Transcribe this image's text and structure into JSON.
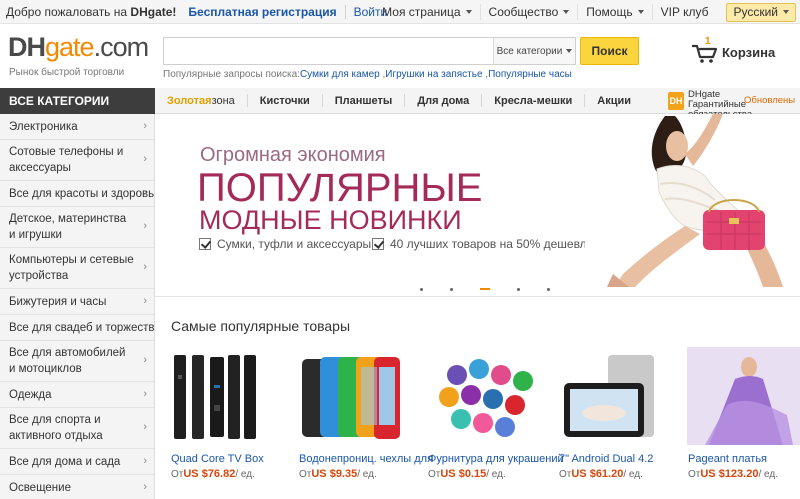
{
  "topbar": {
    "welcome": "Добро пожаловать на ",
    "welcome_brand": "DHgate!",
    "register": "Бесплатная регистрация",
    "login": "Войти",
    "my_page": "Моя страница",
    "community": "Сообщество",
    "help": "Помощь",
    "vip": "VIP клуб",
    "language": "Русский"
  },
  "header": {
    "logo_dh": "DH",
    "logo_gate": "gate",
    "logo_com": ".com",
    "tagline": "Рынок быстрой торговли",
    "search_placeholder": "",
    "category_select": "Все категории",
    "search_button": "Поиск",
    "popular_label": "Популярные запросы поиска:",
    "popular_links": [
      "Сумки для камер",
      "Игрушки на запястье",
      "Популярные часы"
    ],
    "cart_count": "1",
    "cart_label": "Корзина"
  },
  "nav": {
    "all_categories": "ВСЕ КАТЕГОРИИ",
    "gold": "Золотая",
    "zone": " зона",
    "items": [
      "Кисточки",
      "Планшеты",
      "Для дома",
      "Кресла-мешки",
      "Акции"
    ],
    "guarantee_badge": "DH",
    "guarantee_text": "DHgate Гарантийные обязательства",
    "updated": "Обновлены"
  },
  "sidebar": {
    "items": [
      {
        "label": "Электроника"
      },
      {
        "label": "Сотовые телефоны и аксессуары"
      },
      {
        "label": "Все для красоты и здоровья"
      },
      {
        "label": "Детское, материнства и игрушки"
      },
      {
        "label": "Компьютеры и сетевые устройства"
      },
      {
        "label": "Бижутерия и часы"
      },
      {
        "label": "Все для свадеб и торжеств"
      },
      {
        "label": "Все для автомобилей и мотоциклов"
      },
      {
        "label": "Одежда"
      },
      {
        "label": "Все для спорта и активного отдыха"
      },
      {
        "label": "Все для дома и сада"
      },
      {
        "label": "Освещение"
      }
    ]
  },
  "banner": {
    "kicker": "Огромная экономия",
    "headline1": "ПОПУЛЯРНЫЕ",
    "headline2": "МОДНЫЕ НОВИНКИ",
    "feature1": "Сумки, туфли и аксессуары",
    "feature2": "40 лучших товаров на 50% дешевле",
    "slides_total": 5,
    "active_slide": 3
  },
  "products": {
    "title": "Самые популярные товары",
    "from": "От",
    "unit": "/ ед.",
    "items": [
      {
        "name": "Quad Core TV Box",
        "price": "US $76.82"
      },
      {
        "name": "Водонепрониц. чехлы для",
        "price": "US $9.35"
      },
      {
        "name": "Фурнитура для украшений",
        "price": "US $0.15"
      },
      {
        "name": "7\" Android Dual 4.2",
        "price": "US $61.20"
      },
      {
        "name": "Pageant платья",
        "price": "US $123.20"
      }
    ]
  },
  "colors": {
    "accent": "#f08a00",
    "link": "#1a56a8",
    "headline": "#a42a5a",
    "price": "#d8460b",
    "search_button": "#fbd53e"
  }
}
